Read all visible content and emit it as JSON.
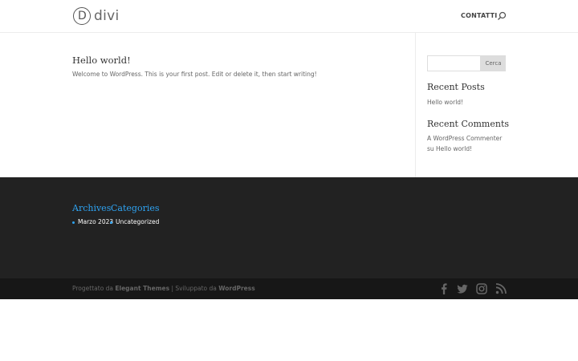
{
  "header": {
    "logo_letter": "D",
    "logo_text": "divi",
    "nav_contatti": "CONTATTI"
  },
  "main": {
    "post_title": "Hello world!",
    "post_excerpt": "Welcome to WordPress. This is your first post. Edit or delete it, then start writing!"
  },
  "sidebar": {
    "search_placeholder": "",
    "search_button": "Cerca",
    "recent_posts_title": "Recent Posts",
    "recent_posts": [
      "Hello world!"
    ],
    "recent_comments_title": "Recent Comments",
    "comment_author": "A WordPress Commenter",
    "comment_on": "su Hello world!"
  },
  "footer": {
    "archives_title": "Archives",
    "archives_items": [
      "Marzo 2023"
    ],
    "categories_title": "Categories",
    "categories_items": [
      "Uncategorized"
    ]
  },
  "bottom_bar": {
    "credits_prefix": "Progettato da ",
    "credits_theme": "Elegant Themes",
    "credits_mid": " | Sviluppato da ",
    "credits_wp": "WordPress",
    "social_icons": [
      "facebook-icon",
      "twitter-icon",
      "instagram-icon",
      "rss-icon"
    ]
  },
  "colors": {
    "accent": "#2ea3f2",
    "footer_bg": "#222222",
    "bottom_bar_bg": "#171717"
  }
}
